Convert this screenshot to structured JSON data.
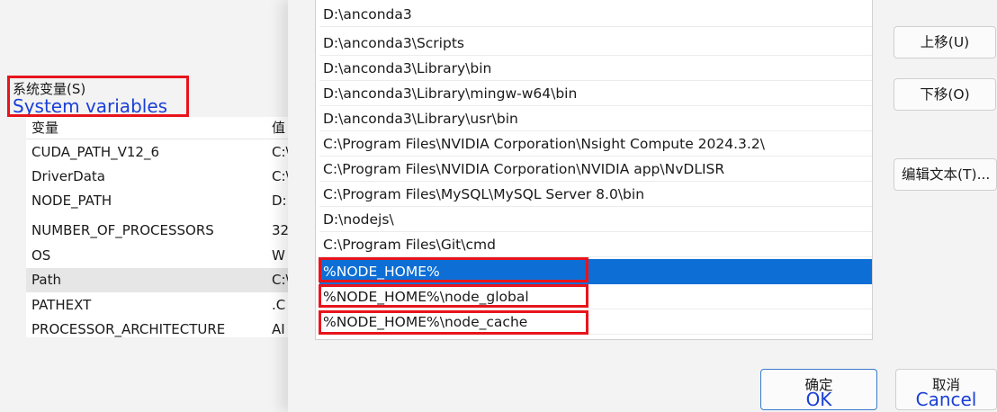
{
  "system_variables": {
    "heading": "系统变量(S)",
    "annotation": "System variables",
    "columns": [
      "变量",
      "值"
    ],
    "rows": [
      {
        "name": "CUDA_PATH_V12_6",
        "value": "C:\\"
      },
      {
        "name": "DriverData",
        "value": "C:\\"
      },
      {
        "name": "NODE_PATH",
        "value": "D:"
      },
      {
        "name": "NUMBER_OF_PROCESSORS",
        "value": "32"
      },
      {
        "name": "OS",
        "value": "W"
      },
      {
        "name": "Path",
        "value": "C:\\"
      },
      {
        "name": "PATHEXT",
        "value": ".C"
      },
      {
        "name": "PROCESSOR_ARCHITECTURE",
        "value": "AI"
      }
    ],
    "selected_index": 5
  },
  "path_list": {
    "items": [
      "D:\\anconda3",
      "D:\\anconda3\\Scripts",
      "D:\\anconda3\\Library\\bin",
      "D:\\anconda3\\Library\\mingw-w64\\bin",
      "D:\\anconda3\\Library\\usr\\bin",
      "C:\\Program Files\\NVIDIA Corporation\\Nsight Compute 2024.3.2\\",
      "C:\\Program Files\\NVIDIA Corporation\\NVIDIA app\\NvDLISR",
      "C:\\Program Files\\MySQL\\MySQL Server 8.0\\bin",
      "D:\\nodejs\\",
      "C:\\Program Files\\Git\\cmd",
      "%NODE_HOME%",
      "%NODE_HOME%\\node_global",
      "%NODE_HOME%\\node_cache"
    ],
    "selected_index": 10
  },
  "buttons": {
    "move_up": "上移(U)",
    "move_down": "下移(O)",
    "edit_text": "编辑文本(T)...",
    "ok": "确定",
    "ok_annotation": "OK",
    "cancel": "取消",
    "cancel_annotation": "Cancel"
  },
  "colors": {
    "selection": "#0d6fd6",
    "annotation_box": "#e8141c",
    "annotation_text": "#1a3fd6"
  }
}
